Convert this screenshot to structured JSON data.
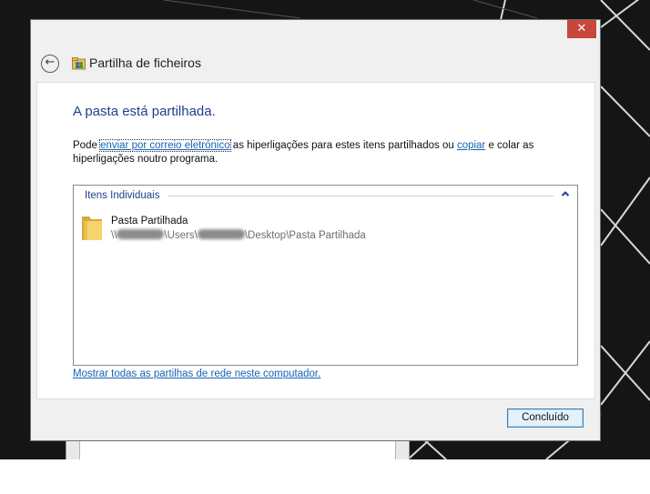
{
  "window": {
    "title": "Partilha de ficheiros",
    "close_glyph": "✕",
    "back_glyph": "←"
  },
  "main": {
    "heading": "A pasta está partilhada.",
    "paragraph": {
      "before_link1": "Pode ",
      "link1": "enviar por correio eletrónico",
      "between": " as hiperligações para estes itens partilhados ou ",
      "link2": "copiar",
      "after": " e colar as hiperligações noutro programa."
    },
    "group": {
      "label": "Itens Individuais",
      "collapse_glyph": "^"
    },
    "item": {
      "name": "Pasta Partilhada",
      "path_prefix": "\\\\",
      "path_mid": "\\Users\\",
      "path_suffix": "\\Desktop\\Pasta Partilhada"
    },
    "show_all_link": "Mostrar todas as partilhas de rede neste computador."
  },
  "footer": {
    "done_label": "Concluído"
  },
  "colors": {
    "accent_heading": "#1f3f8f",
    "link": "#1464b4",
    "close_button": "#c7473b",
    "desktop_background": "#151515"
  },
  "icons": [
    "arrow-left-icon",
    "share-folder-icon",
    "folder-icon",
    "chevron-up-icon",
    "close-icon"
  ]
}
